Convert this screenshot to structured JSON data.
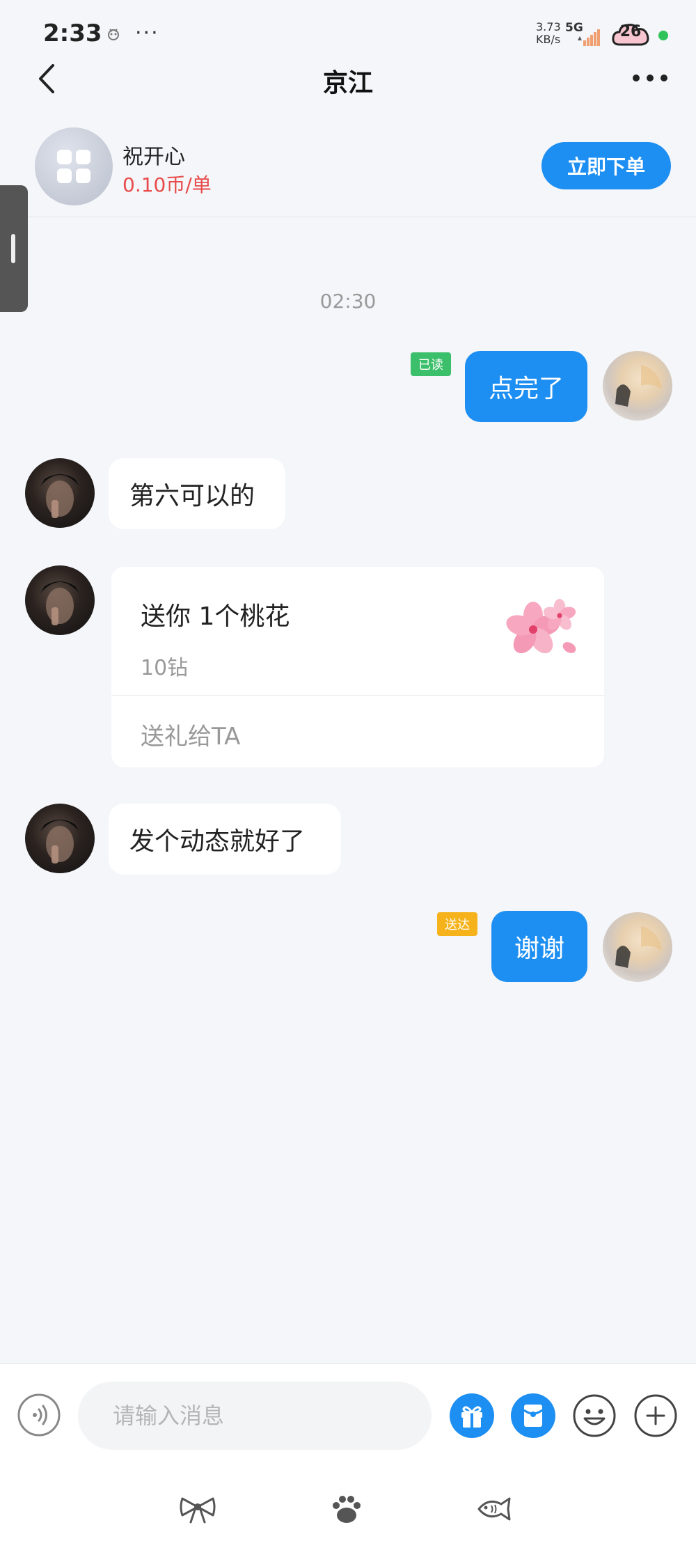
{
  "status_bar": {
    "time": "2:33",
    "dots": "···",
    "net_speed_value": "3.73",
    "net_speed_unit": "KB/s",
    "network_type": "5G",
    "battery": "26"
  },
  "nav": {
    "title": "京江"
  },
  "service": {
    "name": "祝开心",
    "price": "0.10币/单",
    "order_label": "立即下单"
  },
  "timestamp": "02:30",
  "messages": [
    {
      "direction": "out",
      "text": "点完了",
      "status": "已读",
      "status_color": "#3cbf6a"
    },
    {
      "direction": "in",
      "text": "第六可以的"
    },
    {
      "direction": "in",
      "type": "gift",
      "title": "送你 1个桃花",
      "price": "10钻",
      "action": "送礼给TA"
    },
    {
      "direction": "in",
      "text": "发个动态就好了"
    },
    {
      "direction": "out",
      "text": "谢谢",
      "status": "送达",
      "status_color": "#f5b21b"
    }
  ],
  "input": {
    "placeholder": "请输入消息"
  },
  "toolbar_icons": [
    "voice-icon",
    "gift-icon",
    "red-packet-icon",
    "emoji-icon",
    "plus-icon"
  ],
  "bottom_tabs": [
    "bow-icon",
    "paw-icon",
    "fish-icon"
  ],
  "colors": {
    "accent": "#1e8ff2",
    "price_red": "#e84b4b",
    "background": "#f4f6f9"
  }
}
